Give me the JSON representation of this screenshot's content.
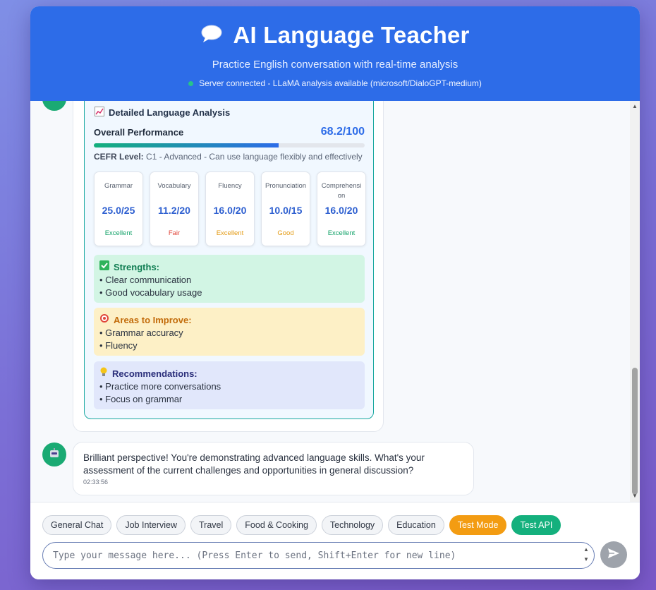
{
  "header": {
    "title": "AI Language Teacher",
    "subtitle": "Practice English conversation with real-time analysis",
    "status": "Server connected - LLaMA analysis available (microsoft/DialoGPT-medium)"
  },
  "analysis": {
    "title": "Detailed Language Analysis",
    "overall_label": "Overall Performance",
    "overall_score": "68.2/100",
    "overall_progress": 0.682,
    "cefr_label": "CEFR Level:",
    "cefr_value": "C1 - Advanced - Can use language flexibly and effectively",
    "metrics": [
      {
        "name": "Grammar",
        "score": "25.0/25",
        "rating": "Excellent",
        "rating_color": "#14a36a"
      },
      {
        "name": "Vocabulary",
        "score": "11.2/20",
        "rating": "Fair",
        "rating_color": "#e0463a"
      },
      {
        "name": "Fluency",
        "score": "16.0/20",
        "rating": "Excellent",
        "rating_color": "#e39a12"
      },
      {
        "name": "Pronunciation",
        "score": "10.0/15",
        "rating": "Good",
        "rating_color": "#e39a12"
      },
      {
        "name": "Comprehension",
        "score": "16.0/20",
        "rating": "Excellent",
        "rating_color": "#14a36a"
      }
    ],
    "strengths": {
      "title": "Strengths:",
      "items": [
        "• Clear communication",
        "• Good vocabulary usage"
      ]
    },
    "improve": {
      "title": "Areas to Improve:",
      "items": [
        "• Grammar accuracy",
        "• Fluency"
      ]
    },
    "recommendations": {
      "title": "Recommendations:",
      "items": [
        "• Practice more conversations",
        "• Focus on grammar"
      ]
    }
  },
  "message": {
    "text": "Brilliant perspective! You're demonstrating advanced language skills. What's your assessment of the current challenges and opportunities in general discussion?",
    "time": "02:33:56"
  },
  "topics": [
    "General Chat",
    "Job Interview",
    "Travel",
    "Food & Cooking",
    "Technology",
    "Education"
  ],
  "test_mode_label": "Test Mode",
  "test_api_label": "Test API",
  "input": {
    "placeholder": "Type your message here... (Press Enter to send, Shift+Enter for new line)",
    "value": ""
  }
}
